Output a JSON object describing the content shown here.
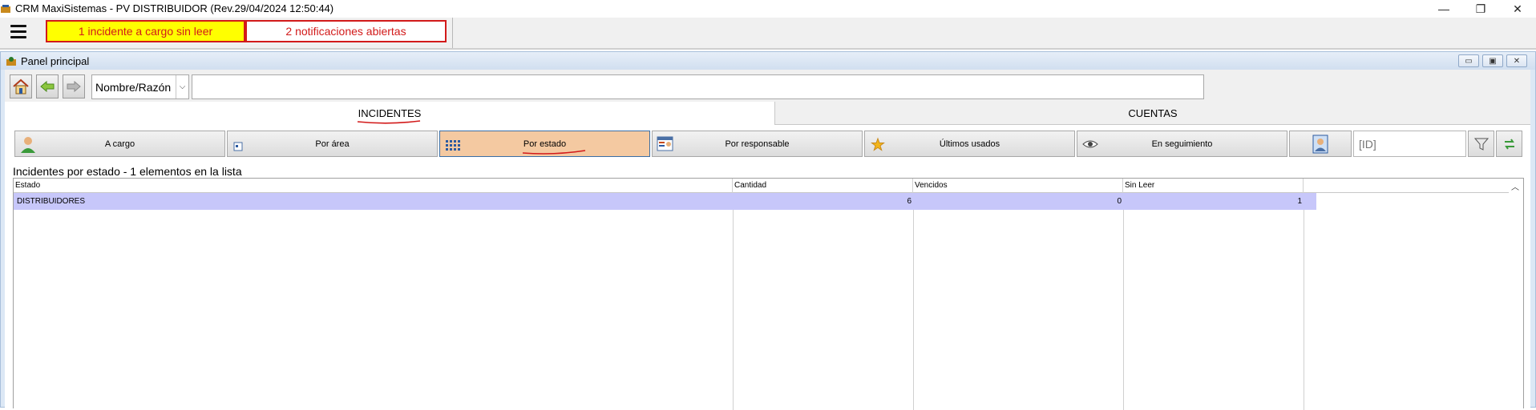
{
  "window": {
    "title": "CRM MaxiSistemas - PV DISTRIBUIDOR (Rev.29/04/2024 12:50:44)",
    "controls": {
      "minimize": "—",
      "restore": "❐",
      "close": "✕"
    }
  },
  "topbar": {
    "menu_icon": "hamburger-icon",
    "alert_unread": "1 incidente a cargo sin leer",
    "alert_notifications": "2 notificaciones abiertas",
    "colors": {
      "alert_bg": "#ffff00",
      "alert_border": "#d21a1a"
    }
  },
  "panel": {
    "title": "Panel principal",
    "controls": {
      "minimize": "▭",
      "maximize": "▣",
      "close": "✕"
    }
  },
  "search": {
    "home_icon": "home-icon",
    "back_icon": "arrow-left-icon",
    "forward_icon": "arrow-right-icon",
    "field": "Nombre/Razón",
    "value": ""
  },
  "tabs": {
    "incidentes": "INCIDENTES",
    "cuentas": "CUENTAS"
  },
  "views": {
    "a_cargo": "A cargo",
    "por_area": "Por área",
    "por_estado": "Por estado",
    "por_responsable": "Por responsable",
    "ultimos_usados": "Últimos usados",
    "en_seguimiento": "En seguimiento",
    "id_placeholder": "[ID]",
    "selected_color": "#f4c9a1"
  },
  "list": {
    "title": "Incidentes por estado - 1 elementos en la lista",
    "columns": [
      "Estado",
      "Cantidad",
      "Vencidos",
      "Sin Leer"
    ],
    "rows": [
      {
        "estado": "DISTRIBUIDORES",
        "cantidad": "6",
        "vencidos": "0",
        "sin_leer": "1"
      }
    ],
    "row_color": "#c7c7fa"
  }
}
